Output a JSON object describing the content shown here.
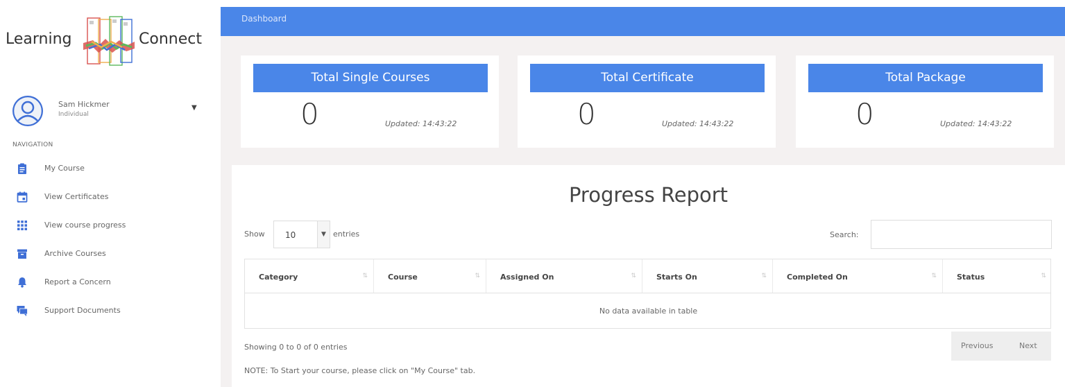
{
  "logo": {
    "text_left": "Learning",
    "text_right": "Connect"
  },
  "user": {
    "name": "Sam Hickmer",
    "role": "Individual"
  },
  "nav": {
    "heading": "NAVIGATION",
    "items": [
      {
        "label": "My Course",
        "icon": "clipboard-icon"
      },
      {
        "label": "View Certificates",
        "icon": "calendar-icon"
      },
      {
        "label": "View course progress",
        "icon": "grid-icon"
      },
      {
        "label": "Archive Courses",
        "icon": "archive-icon"
      },
      {
        "label": "Report a Concern",
        "icon": "bell-icon"
      },
      {
        "label": "Support Documents",
        "icon": "chat-icon"
      }
    ]
  },
  "topbar": {
    "title": "Dashboard"
  },
  "cards": [
    {
      "title": "Total Single Courses",
      "value": "0",
      "updated": "Updated: 14:43:22"
    },
    {
      "title": "Total Certificate",
      "value": "0",
      "updated": "Updated: 14:43:22"
    },
    {
      "title": "Total Package",
      "value": "0",
      "updated": "Updated: 14:43:22"
    }
  ],
  "report": {
    "title": "Progress Report",
    "show_label": "Show",
    "length_value": "10",
    "entries_label": "entries",
    "search_label": "Search:",
    "search_value": "",
    "columns": [
      "Category",
      "Course",
      "Assigned On",
      "Starts On",
      "Completed On",
      "Status"
    ],
    "empty_text": "No data available in table",
    "info_text": "Showing 0 to 0 of 0 entries",
    "prev_label": "Previous",
    "next_label": "Next",
    "note": "NOTE: To Start your course, please click on \"My Course\" tab."
  },
  "colors": {
    "accent": "#4a86e8",
    "main_bg": "#f4f1f1",
    "nav_icon": "#3f6fd6"
  }
}
